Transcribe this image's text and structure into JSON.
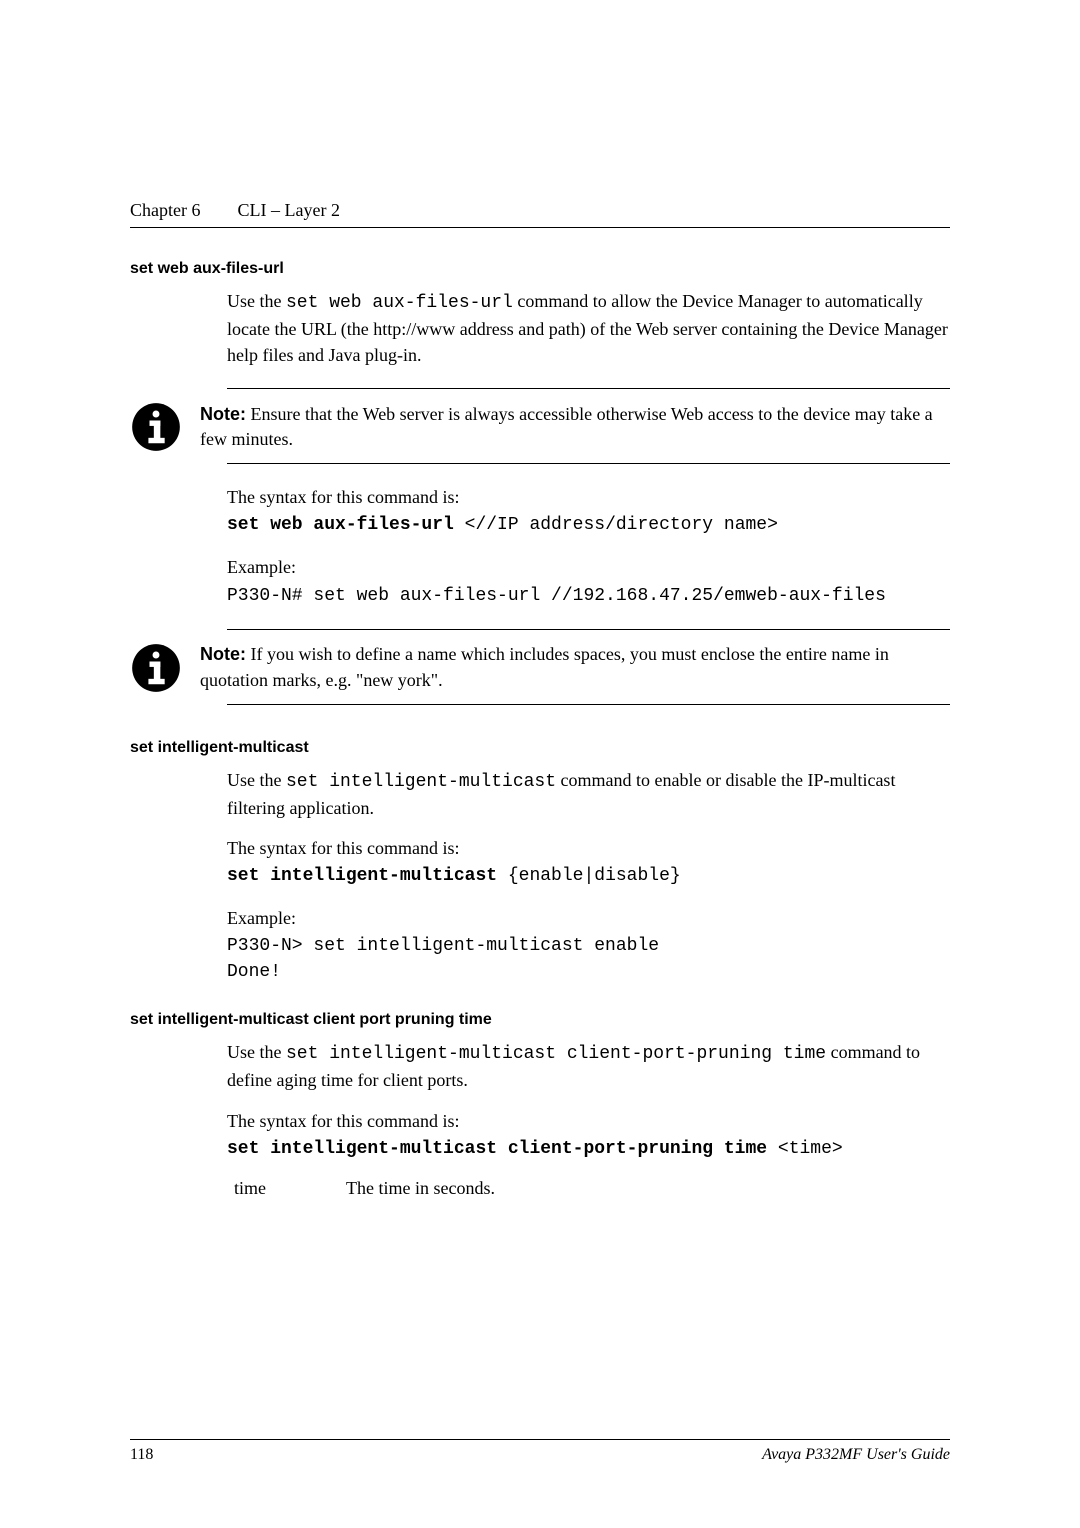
{
  "header": {
    "chapter": "Chapter 6",
    "title": "CLI – Layer 2"
  },
  "s1": {
    "heading": "set web aux-files-url",
    "intro": "Use the ",
    "introCmd": "set web aux-files-url",
    "introRest": " command to allow the Device Manager to automatically locate the URL (the http://www address and path) of the Web server containing the Device Manager help files and Java plug-in.",
    "note1Label": "Note:",
    "note1Text": "  Ensure that the Web server is always accessible otherwise Web access to the device may take a few minutes.",
    "syntaxIntro": "The syntax for this command is:",
    "syntaxCmd": "set web aux-files-url",
    "syntaxArgs": " <//IP address/directory name>",
    "exampleLabel": "Example:",
    "exampleLine": "P330-N# set web aux-files-url //192.168.47.25/emweb-aux-files",
    "note2Label": "Note:",
    "note2Text": "  If you wish to define a name which includes spaces, you must enclose the entire name in quotation marks, e.g. \"new york\"."
  },
  "s2": {
    "heading": "set intelligent-multicast",
    "intro": "Use the ",
    "introCmd": "set intelligent-multicast",
    "introRest": " command to enable or disable the IP-multicast filtering application.",
    "syntaxIntro": "The syntax for this command is:",
    "syntaxCmd": "set intelligent-multicast",
    "syntaxArgs": " {enable|disable}",
    "exampleLabel": "Example:",
    "exampleLine1": "P330-N> set intelligent-multicast enable",
    "exampleLine2": "Done!"
  },
  "s3": {
    "heading": "set intelligent-multicast client port pruning time",
    "intro": "Use the ",
    "introCmd": "set intelligent-multicast client-port-pruning time",
    "introRest": " command to define aging time for client ports.",
    "syntaxIntro": "The syntax for this command is:",
    "syntaxCmd": "set intelligent-multicast client-port-pruning time",
    "syntaxArgs": " <time>",
    "paramName": "time",
    "paramDesc": "The time in seconds."
  },
  "footer": {
    "page": "118",
    "guide": "Avaya P332MF User's Guide"
  }
}
